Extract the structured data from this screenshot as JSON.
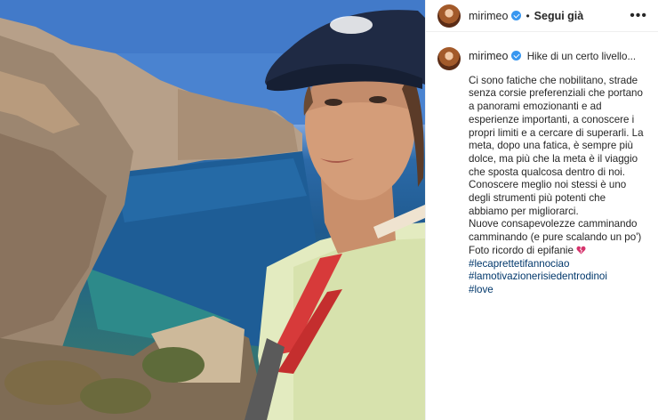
{
  "post": {
    "username": "mirimeo",
    "follow_label": "Segui già",
    "separator": "•",
    "more_label": "•••"
  },
  "caption": {
    "username": "mirimeo",
    "first_line": "Hike di un certo livello...",
    "paragraph": "Ci sono fatiche che nobilitano, strade senza corsie preferenziali che portano a panorami emozionanti e ad esperienze importanti, a conoscere i propri limiti e a cercare di superarli. La meta, dopo una fatica, è sempre più dolce, ma più che la meta è il viaggio che sposta qualcosa dentro di noi.\nConoscere meglio noi stessi è uno degli strumenti più potenti che abbiamo per migliorarci.\nNuove consapevolezze camminando camminando (e pure scalando un po')\nFoto ricordo di epifanie",
    "hashtags": [
      "#lecaprettetifannociao",
      "#lamotivazionerisiedentrodinoi",
      "#love"
    ]
  },
  "colors": {
    "link": "#00376b",
    "verified": "#3897f0",
    "heart": "#d6336c"
  },
  "icons": {
    "verified": "verified-badge-icon",
    "more": "more-options-icon",
    "emoji": "broken-heart-emoji"
  }
}
